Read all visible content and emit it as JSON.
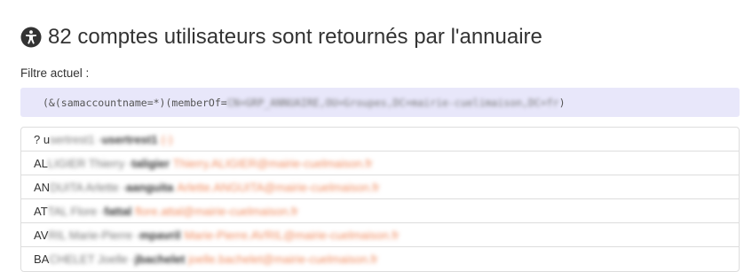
{
  "header": {
    "title": "82 comptes utilisateurs sont retournés par l'annuaire",
    "icon": "accessibility-icon"
  },
  "filter": {
    "label": "Filtre actuel :",
    "visible_text": "(&(samaccountname=*)(memberOf=",
    "redacted_text": "CN=GRP_ANNUAIRE,OU=Groupes,DC=mairie-cuelimaison,DC=fr",
    "closing_text": ")"
  },
  "users": [
    {
      "prefix": "? u",
      "name_rest": "sertrest1 - ",
      "login": "usertrest1",
      "mail": "(-)"
    },
    {
      "prefix": "AL",
      "name_rest": "LIGIER Thierry - ",
      "login": "taligier",
      "mail": "Thierry.ALIGIER@mairie-cuelmaison.fr"
    },
    {
      "prefix": "AN",
      "name_rest": "DUITA Arlette - ",
      "login": "aanguita",
      "mail": "Arlette.ANGUITA@mairie-cuelmaison.fr"
    },
    {
      "prefix": "AT",
      "name_rest": "TAL Flore - ",
      "login": "fattal",
      "mail": "flore.attal@mairie-cuelmaison.fr"
    },
    {
      "prefix": "AV",
      "name_rest": "RIL Marie-Pierre - ",
      "login": "mpavril",
      "mail": "Marie-Pierre.AVRIL@mairie-cuelmaison.fr"
    },
    {
      "prefix": "BA",
      "name_rest": "CHELET Joelle - ",
      "login": "jbachelet",
      "mail": "joelle.bachelet@mairie-cuelmaison.fr"
    }
  ]
}
